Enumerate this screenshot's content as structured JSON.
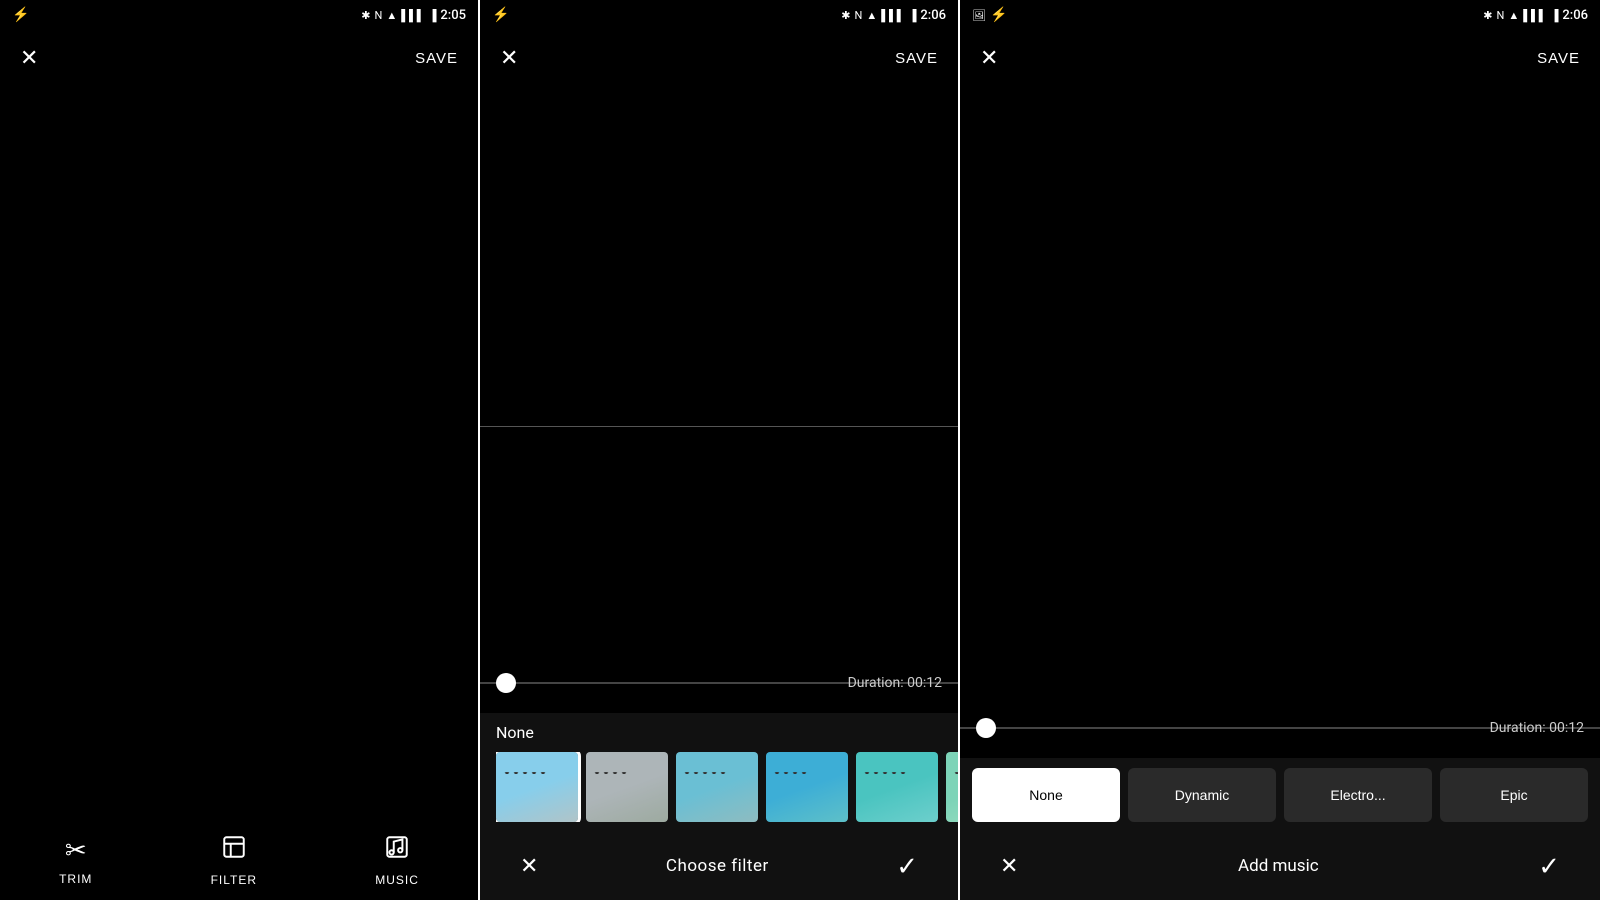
{
  "panels": [
    {
      "id": "panel1",
      "statusBar": {
        "time": "2:05",
        "icons": [
          "bluetooth",
          "nfc",
          "wifi",
          "signal",
          "battery"
        ]
      },
      "topBar": {
        "closeLabel": "✕",
        "saveLabel": "SAVE"
      },
      "scrubber": {
        "durationLabel": null
      },
      "bottomActions": [
        {
          "id": "trim",
          "icon": "✂",
          "label": "TRIM"
        },
        {
          "id": "filter",
          "icon": "🖼",
          "label": "FILTER"
        },
        {
          "id": "music",
          "icon": "🎵",
          "label": "MUSIC"
        }
      ]
    },
    {
      "id": "panel2",
      "statusBar": {
        "time": "2:06"
      },
      "topBar": {
        "closeLabel": "✕",
        "saveLabel": "SAVE"
      },
      "scrubber": {
        "durationLabel": "Duration: 00:12"
      },
      "filterSection": {
        "noneLabel": "None",
        "thumbnails": [
          {
            "id": "t1",
            "colorClass": "thumb-color-1",
            "selected": true
          },
          {
            "id": "t2",
            "colorClass": "thumb-color-2",
            "selected": false
          },
          {
            "id": "t3",
            "colorClass": "thumb-color-3",
            "selected": false
          },
          {
            "id": "t4",
            "colorClass": "thumb-color-4",
            "selected": false
          },
          {
            "id": "t5",
            "colorClass": "thumb-color-5",
            "selected": false
          },
          {
            "id": "t6",
            "colorClass": "thumb-color-6",
            "selected": false
          }
        ]
      },
      "bottomBar": {
        "closeLabel": "✕",
        "title": "Choose filter",
        "confirmLabel": "✓"
      }
    },
    {
      "id": "panel3",
      "statusBar": {
        "time": "2:06"
      },
      "topBar": {
        "closeLabel": "✕",
        "saveLabel": "SAVE"
      },
      "scrubber": {
        "durationLabel": "Duration: 00:12"
      },
      "musicOptions": [
        {
          "id": "none",
          "label": "None",
          "selected": true
        },
        {
          "id": "dynamic",
          "label": "Dynamic",
          "selected": false
        },
        {
          "id": "electro",
          "label": "Electro...",
          "selected": false
        },
        {
          "id": "epic",
          "label": "Epic",
          "selected": false
        }
      ],
      "bottomBar": {
        "closeLabel": "✕",
        "title": "Add music",
        "confirmLabel": "✓"
      }
    }
  ]
}
